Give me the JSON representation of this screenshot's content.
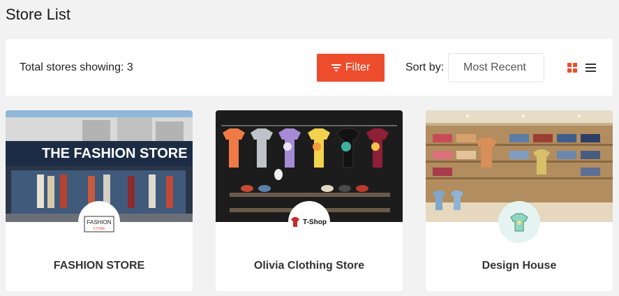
{
  "page": {
    "title": "Store List"
  },
  "toolbar": {
    "total_label": "Total stores showing: 3",
    "filter_label": "Filter",
    "sort_label": "Sort by:",
    "sort_value": "Most Recent",
    "active_view": "grid",
    "accent_color": "#ee4d2d"
  },
  "stores": [
    {
      "name": "FASHION STORE",
      "cover_sign": "THE FASHION STORE",
      "logo_text": "FASHION",
      "logo_subtext": "STORE",
      "cover": "storefront-photo"
    },
    {
      "name": "Olivia Clothing Store",
      "logo_text": "T-Shop",
      "cover": "t-shirt-wall-photo"
    },
    {
      "name": "Design House",
      "cover": "shirt-shelves-photo",
      "logo_icon": "t-shirt-icon"
    }
  ]
}
